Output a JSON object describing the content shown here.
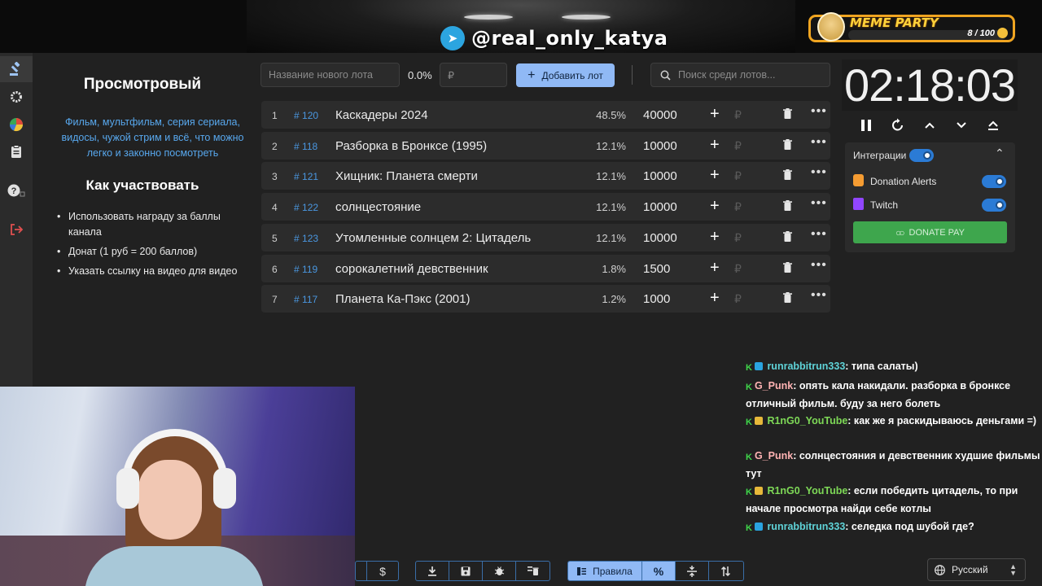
{
  "overlay": {
    "telegram_handle": "@real_only_katya",
    "meme_party": {
      "title": "MEME PARTY",
      "count": "8 / 100"
    }
  },
  "sidebar": {
    "items": [
      "auction-icon",
      "gear-icon",
      "pie-chart-icon",
      "clipboard-icon",
      "help-icon",
      "logout-icon"
    ]
  },
  "rules": {
    "title": "Просмотровый",
    "description": "Фильм, мультфильм, серия сериала, видосы, чужой стрим и всё, что можно легко и законно посмотреть",
    "how_title": "Как участвовать",
    "items": [
      "Использовать награду за баллы канала",
      "Донат (1 руб = 200 баллов)",
      "Указать ссылку на видео для видео"
    ]
  },
  "toolbar": {
    "lot_name_placeholder": "Название нового лота",
    "percent": "0.0%",
    "amount_placeholder": "₽",
    "add_label": "Добавить лот",
    "search_placeholder": "Поиск среди лотов..."
  },
  "lots": [
    {
      "num": "1",
      "id": "120",
      "name": "Каскадеры 2024",
      "pct": "48.5%",
      "amount": "40000"
    },
    {
      "num": "2",
      "id": "118",
      "name": "Разборка в Бронксе (1995)",
      "pct": "12.1%",
      "amount": "10000"
    },
    {
      "num": "3",
      "id": "121",
      "name": "Хищник: Планета смерти",
      "pct": "12.1%",
      "amount": "10000"
    },
    {
      "num": "4",
      "id": "122",
      "name": "солнцестояние",
      "pct": "12.1%",
      "amount": "10000"
    },
    {
      "num": "5",
      "id": "123",
      "name": "Утомленные солнцем 2: Цитадель",
      "pct": "12.1%",
      "amount": "10000"
    },
    {
      "num": "6",
      "id": "119",
      "name": "сорокалетний девственник",
      "pct": "1.8%",
      "amount": "1500"
    },
    {
      "num": "7",
      "id": "117",
      "name": "Планета Ка-Пэкс (2001)",
      "pct": "1.2%",
      "amount": "1000"
    }
  ],
  "lot_currency": "₽",
  "timer": {
    "value": "02:18:03"
  },
  "integrations": {
    "title": "Интеграции",
    "items": [
      {
        "name": "Donation Alerts",
        "enabled": true
      },
      {
        "name": "Twitch",
        "enabled": true
      }
    ],
    "donate_label": "DONATE PAY"
  },
  "chat": [
    {
      "user": "runrabbitrun333",
      "text": ": типа салаты)",
      "color": "#5fd3d8",
      "badge": "blue"
    },
    {
      "user": "G_Punk",
      "text": ": опять кала накидали. разборка в бронксе отличный фильм. буду за него болеть",
      "color": "#ffb3b3",
      "badge": "none"
    },
    {
      "user": "R1nG0_YouTube",
      "text": ": как же я раскидываюсь деньгами =)",
      "color": "#7ed957",
      "badge": "gold"
    },
    {
      "user": "G_Punk",
      "text": ": солнцестояния и девственник худшие фильмы тут",
      "color": "#ffb3b3",
      "badge": "none"
    },
    {
      "user": "R1nG0_YouTube",
      "text": ": если победить цитадель, то при начале просмотра найди себе котлы",
      "color": "#7ed957",
      "badge": "gold"
    },
    {
      "user": "runrabbitrun333",
      "text": ": селедка под шубой где?",
      "color": "#5fd3d8",
      "badge": "blue"
    }
  ],
  "bottom": {
    "rules_label": "Правила",
    "dollar": "$",
    "percent": "%",
    "language": "Русский"
  }
}
